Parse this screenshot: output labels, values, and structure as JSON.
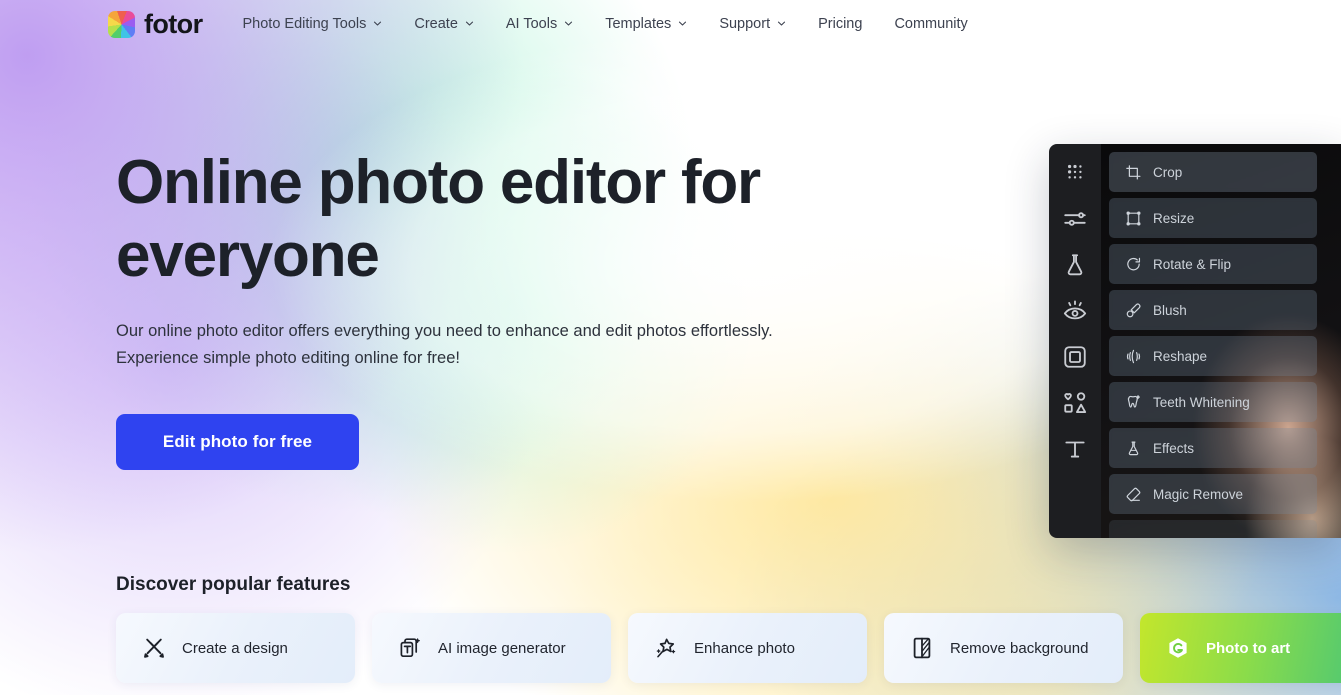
{
  "header": {
    "logo_text": "fotor",
    "logo_icon": "color-wheel-icon",
    "nav": [
      {
        "label": "Photo Editing Tools",
        "has_caret": true
      },
      {
        "label": "Create",
        "has_caret": true
      },
      {
        "label": "AI Tools",
        "has_caret": true
      },
      {
        "label": "Templates",
        "has_caret": true
      },
      {
        "label": "Support",
        "has_caret": true
      },
      {
        "label": "Pricing",
        "has_caret": false
      },
      {
        "label": "Community",
        "has_caret": false
      }
    ]
  },
  "hero": {
    "title_line1": "Online photo editor for",
    "title_line2": "everyone",
    "subtitle_line1": "Our online photo editor offers everything you need to enhance and edit photos effortlessly.",
    "subtitle_line2": "Experience simple photo editing online for free!",
    "cta_label": "Edit photo for free",
    "cta_color": "#2f43f0"
  },
  "editor_preview": {
    "rail_icons": [
      "dots-grid-icon",
      "sliders-icon",
      "flask-icon",
      "eye-retouch-icon",
      "frame-icon",
      "shapes-icon",
      "text-icon"
    ],
    "tools": [
      {
        "label": "Crop",
        "icon": "crop-icon"
      },
      {
        "label": "Resize",
        "icon": "resize-icon"
      },
      {
        "label": "Rotate & Flip",
        "icon": "rotate-icon"
      },
      {
        "label": "Blush",
        "icon": "blush-icon"
      },
      {
        "label": "Reshape",
        "icon": "reshape-icon"
      },
      {
        "label": "Teeth Whitening",
        "icon": "tooth-icon"
      },
      {
        "label": "Effects",
        "icon": "effects-flask-icon"
      },
      {
        "label": "Magic Remove",
        "icon": "eraser-icon"
      }
    ]
  },
  "discover": {
    "heading": "Discover popular features",
    "cards": [
      {
        "label": "Create a design",
        "icon": "crossed-pencils-icon",
        "accent": false
      },
      {
        "label": "AI image generator",
        "icon": "stacked-cards-sparkle-icon",
        "accent": false
      },
      {
        "label": "Enhance photo",
        "icon": "magic-wand-sparkle-icon",
        "accent": false
      },
      {
        "label": "Remove background",
        "icon": "background-remove-icon",
        "accent": false
      },
      {
        "label": "Photo to art",
        "icon": "hexagon-g-icon",
        "accent": true,
        "accent_color": "#8bdc4a"
      }
    ]
  }
}
